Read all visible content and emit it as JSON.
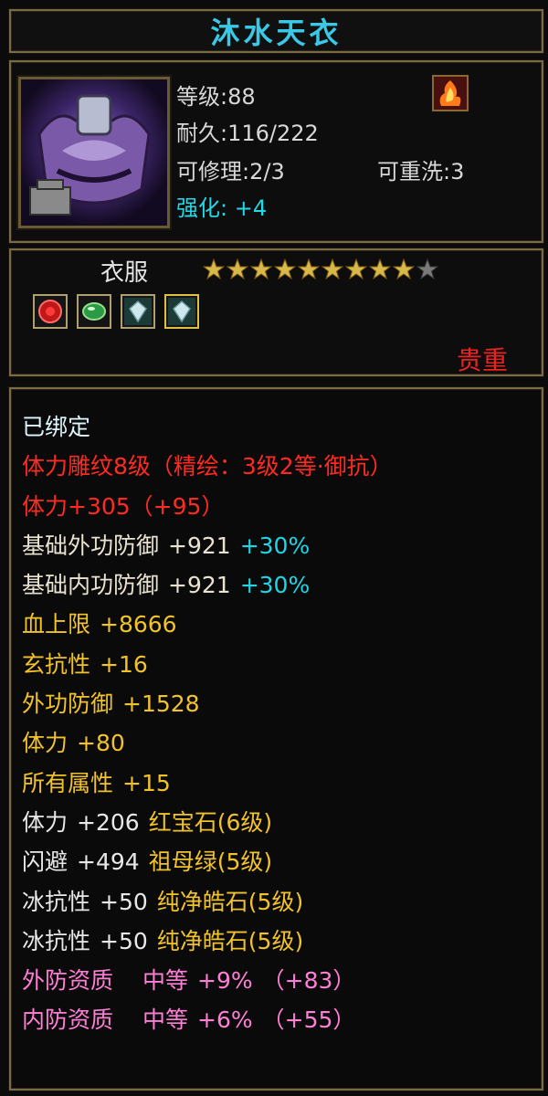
{
  "item": {
    "name": "沐水天衣",
    "level": "等级:88",
    "durability": "耐久:116/222",
    "repair": "可修理:2/3",
    "rewash": "可重洗:3",
    "enhance_label": "强化:",
    "enhance_value": "+4",
    "type": "衣服",
    "rarity": "贵重",
    "stars": {
      "filled": 9,
      "total": 10
    }
  },
  "gems": [
    {
      "name": "red-gem-icon",
      "color": "#d01818"
    },
    {
      "name": "green-gem-icon",
      "color": "#2aa84a"
    },
    {
      "name": "white-gem-icon",
      "color": "#b8d0d8"
    },
    {
      "name": "white-gem-icon",
      "color": "#b8d0d8"
    }
  ],
  "attributes": {
    "bound": "已绑定",
    "engrave": "体力雕纹8级（精绘：3级2等·御抗）",
    "stamina_bonus": "体力+305（+95）",
    "base_outer_def": {
      "label": "基础外功防御",
      "value": "+921",
      "percent": "+30%"
    },
    "base_inner_def": {
      "label": "基础内功防御",
      "value": "+921",
      "percent": "+30%"
    },
    "hp_max": {
      "label": "血上限",
      "value": "+8666"
    },
    "xuan_res": {
      "label": "玄抗性",
      "value": "+16"
    },
    "outer_def": {
      "label": "外功防御",
      "value": "+1528"
    },
    "stamina": {
      "label": "体力",
      "value": "+80"
    },
    "all_attr": {
      "label": "所有属性",
      "value": "+15"
    },
    "gem_lines": [
      {
        "label": "体力",
        "value": "+206",
        "gem": "红宝石(6级)"
      },
      {
        "label": "闪避",
        "value": "+494",
        "gem": "祖母绿(5级)"
      },
      {
        "label": "冰抗性",
        "value": "+50",
        "gem": "纯净皓石(5级)"
      },
      {
        "label": "冰抗性",
        "value": "+50",
        "gem": "纯净皓石(5级)"
      }
    ],
    "quality_lines": [
      {
        "label": "外防资质",
        "grade": "中等",
        "value": "+9%",
        "extra": "（+83）"
      },
      {
        "label": "内防资质",
        "grade": "中等",
        "value": "+6%",
        "extra": "（+55）"
      }
    ]
  },
  "colors": {
    "title": "#39c8e6",
    "enhance": "#21d8e6",
    "rarity": "#ee2222",
    "engrave": "#ff2a22",
    "stat": "#f1c22a",
    "quality": "#ff7fd6"
  }
}
